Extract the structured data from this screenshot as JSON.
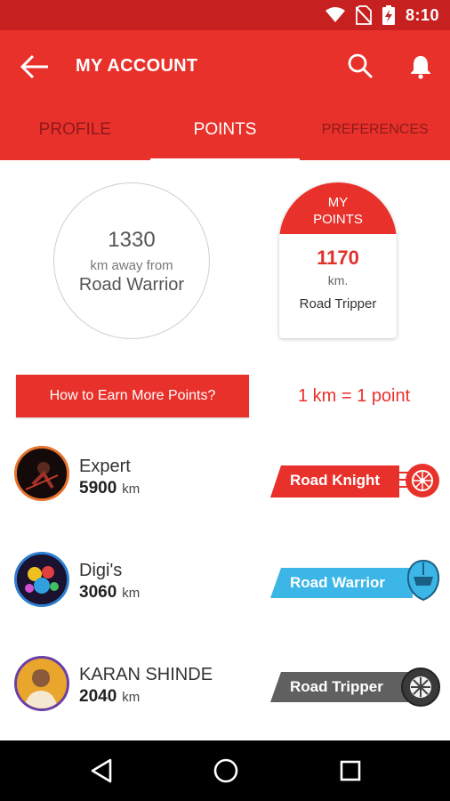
{
  "status_bar": {
    "time": "8:10",
    "icons": [
      "wifi-icon",
      "no-sim-icon",
      "battery-charging-icon"
    ]
  },
  "app_bar": {
    "title": "MY ACCOUNT",
    "back_icon": "arrow-left-icon",
    "search_icon": "search-icon",
    "notification_icon": "bell-icon"
  },
  "tabs": [
    {
      "label": "PROFILE",
      "active": false
    },
    {
      "label": "POINTS",
      "active": true
    },
    {
      "label": "PREFERENCES",
      "active": false
    }
  ],
  "progress": {
    "distance": "1330",
    "away_text": "km away from",
    "target_level": "Road Warrior"
  },
  "my_points": {
    "heading_line1": "MY",
    "heading_line2": "POINTS",
    "value": "1170",
    "unit": "km.",
    "level": "Road Tripper"
  },
  "earn_button": {
    "label": "How to Earn More Points?"
  },
  "rate_text": "1 km = 1 point",
  "leaderboard": [
    {
      "name": "Expert",
      "score": "5900",
      "unit": "km",
      "badge": "Road Knight",
      "badge_color": "#e8312b",
      "badge_icon": "wheel-icon"
    },
    {
      "name": "Digi's",
      "score": "3060",
      "unit": "km",
      "badge": "Road Warrior",
      "badge_color": "#3cb6e6",
      "badge_icon": "helmet-icon"
    },
    {
      "name": "KARAN SHINDE",
      "score": "2040",
      "unit": "km",
      "badge": "Road Tripper",
      "badge_color": "#606060",
      "badge_icon": "tyre-icon"
    }
  ],
  "colors": {
    "primary": "#e8312b",
    "status_bar": "#c62020",
    "tab_inactive": "#8e1a1a"
  },
  "nav_bar": {
    "icons": [
      "back-triangle-icon",
      "home-circle-icon",
      "recents-square-icon"
    ]
  }
}
